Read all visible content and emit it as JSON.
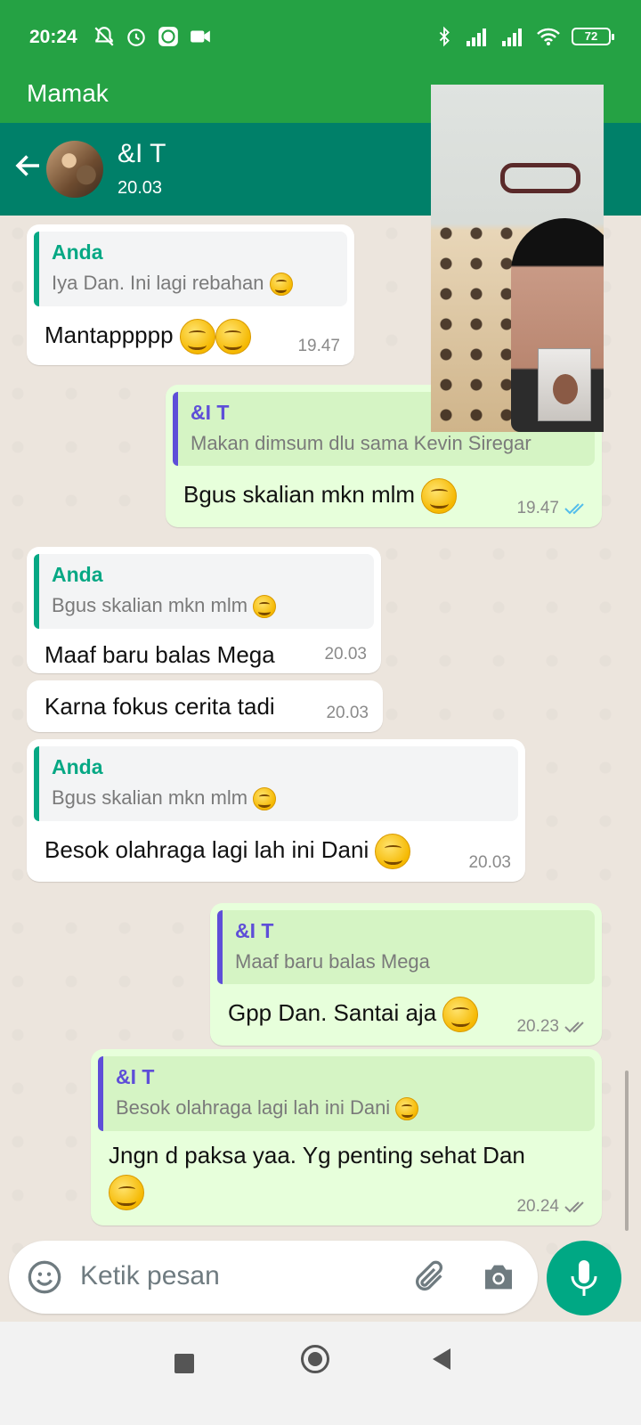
{
  "status_bar": {
    "time": "20:24",
    "battery": "72"
  },
  "call_banner": {
    "name": "Mamak"
  },
  "header": {
    "title": "&I T",
    "subtitle": "20.03"
  },
  "messages": [
    {
      "dir": "in",
      "quote_author": "Anda",
      "quote_text": "Iya Dan. Ini lagi rebahan",
      "text": "Mantappppp",
      "time": "19.47"
    },
    {
      "dir": "out",
      "quote_author": "&I T",
      "quote_text": "Makan dimsum dlu sama Kevin Siregar",
      "text": "Bgus skalian mkn mlm",
      "time": "19.47",
      "status": "read"
    },
    {
      "dir": "in",
      "quote_author": "Anda",
      "quote_text": "Bgus skalian mkn mlm",
      "text": "Maaf baru balas Mega",
      "time": "20.03"
    },
    {
      "dir": "in",
      "text": "Karna fokus cerita tadi",
      "time": "20.03"
    },
    {
      "dir": "in",
      "quote_author": "Anda",
      "quote_text": "Bgus skalian mkn mlm",
      "text": "Besok olahraga lagi lah ini Dani",
      "time": "20.03"
    },
    {
      "dir": "out",
      "quote_author": "&I T",
      "quote_text": "Maaf baru balas Mega",
      "text": "Gpp Dan. Santai aja",
      "time": "20.23",
      "status": "delivered"
    },
    {
      "dir": "out",
      "quote_author": "&I T",
      "quote_text": "Besok olahraga lagi lah ini Dani",
      "text": "Jngn d paksa yaa. Yg penting sehat Dan",
      "time": "20.24",
      "status": "delivered"
    }
  ],
  "composer": {
    "placeholder": "Ketik pesan"
  },
  "icons": {
    "back": "arrow-left-icon",
    "emoji": "emoji-icon",
    "attach": "paperclip-icon",
    "camera": "camera-icon",
    "mic": "mic-icon"
  },
  "colors": {
    "status_bar": "#25a244",
    "header": "#008069",
    "incoming": "#ffffff",
    "outgoing": "#e7ffdb",
    "anda_accent": "#06a884",
    "it_accent": "#5e4ed8",
    "read_ticks": "#53bdeb"
  }
}
